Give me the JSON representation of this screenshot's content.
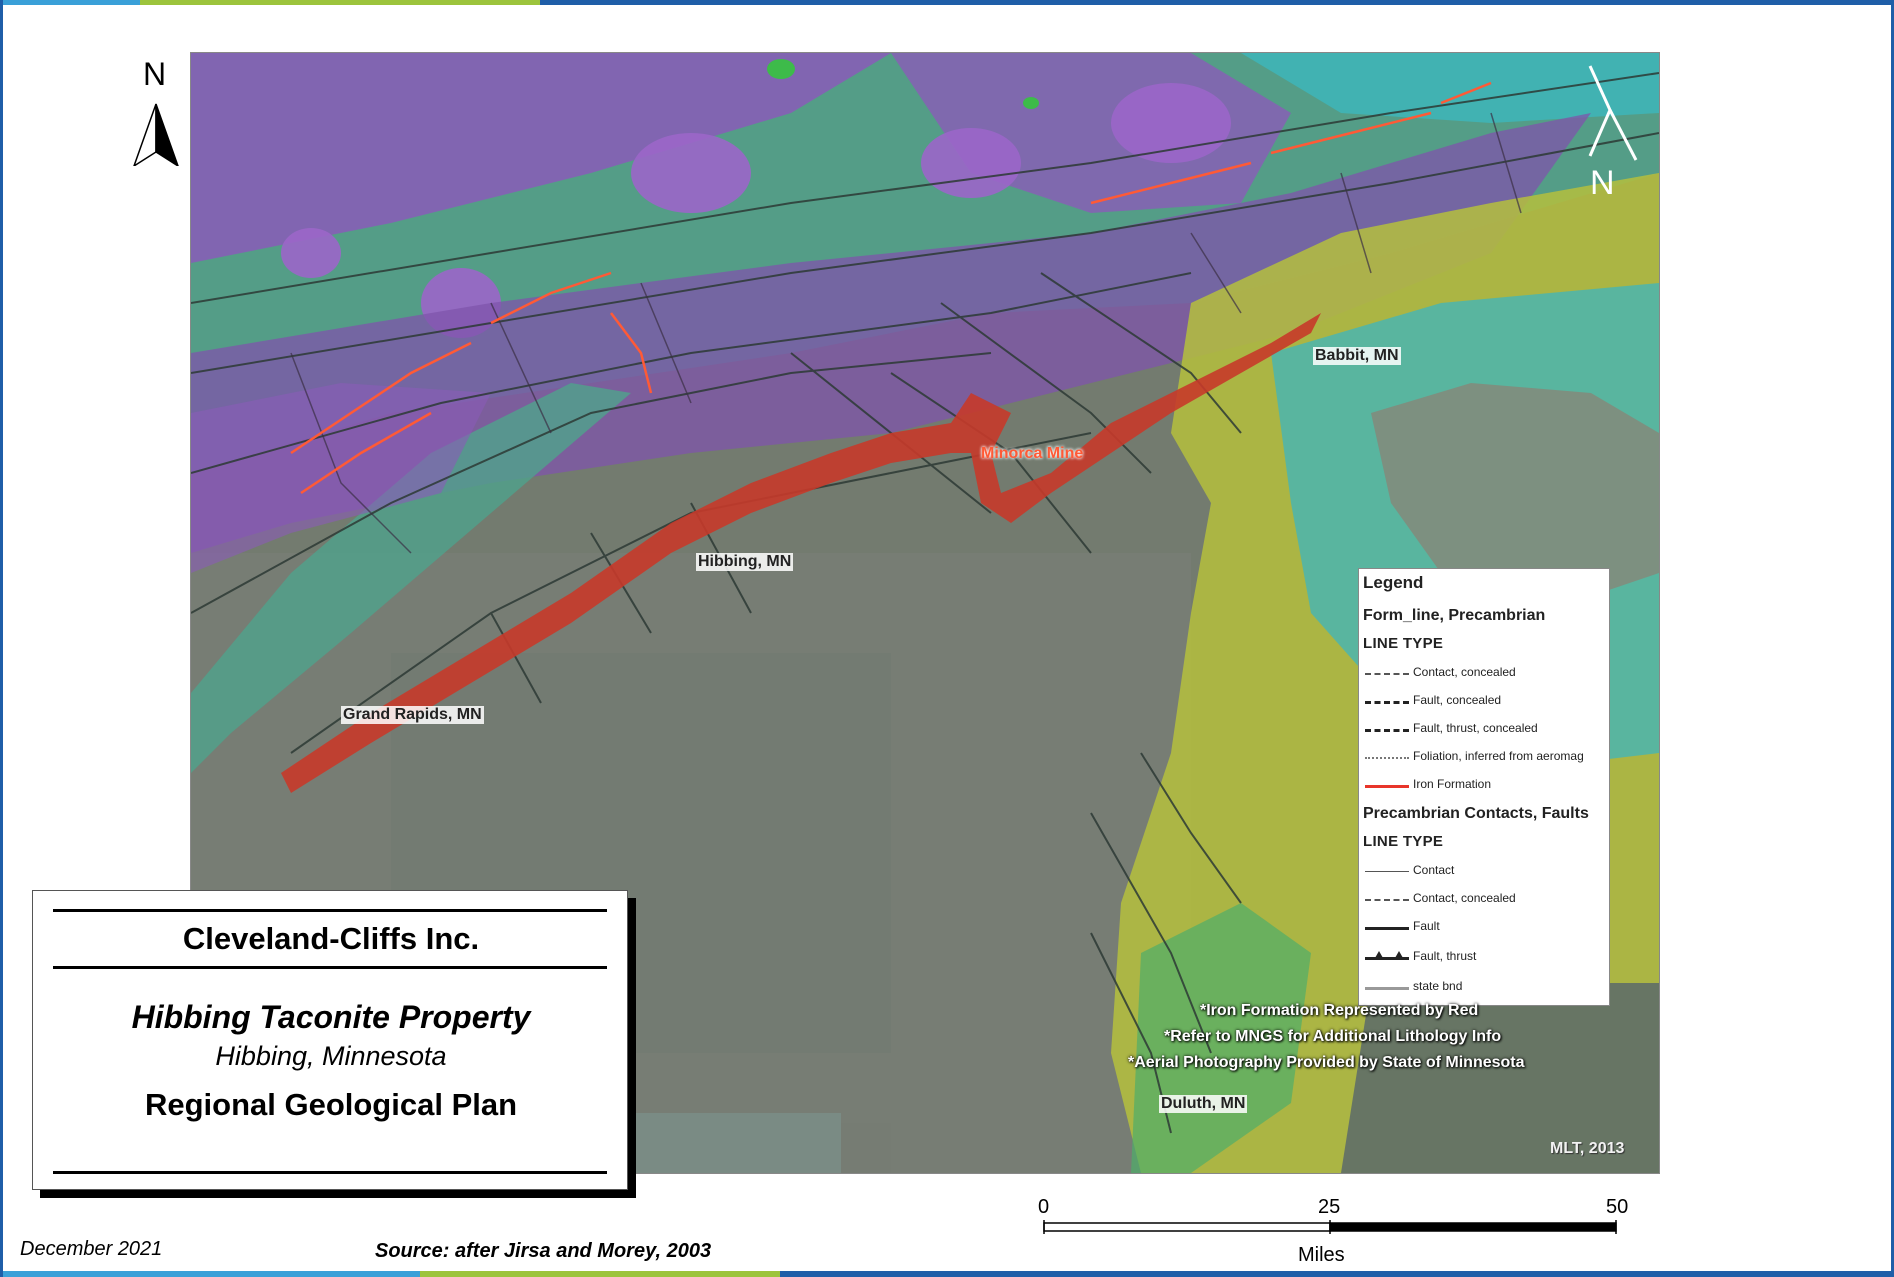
{
  "map": {
    "cities": [
      {
        "id": "babbit",
        "label": "Babbit, MN"
      },
      {
        "id": "minorca",
        "label": "Minorca Mine"
      },
      {
        "id": "hibbing",
        "label": "Hibbing, MN"
      },
      {
        "id": "grand-rapids",
        "label": "Grand Rapids, MN"
      },
      {
        "id": "duluth",
        "label": "Duluth, MN"
      }
    ],
    "north_label": "N",
    "notes": [
      "*Iron Formation Represented by Red",
      "*Refer to MNGS for Additional Lithology Info",
      "*Aerial Photography Provided by State of Minnesota"
    ],
    "credit": "MLT, 2013"
  },
  "legend": {
    "title": "Legend",
    "group1": {
      "header": "Form_line, Precambrian",
      "subheader": "LINE TYPE",
      "items": [
        {
          "label": "Contact, concealed",
          "style": "dash-thin",
          "color": "#555555"
        },
        {
          "label": "Fault, concealed",
          "style": "dash-thick",
          "color": "#222222"
        },
        {
          "label": "Fault, thrust, concealed",
          "style": "dash-thick",
          "color": "#222222"
        },
        {
          "label": "Foliation, inferred from aeromag",
          "style": "dotted",
          "color": "#777777"
        },
        {
          "label": "Iron Formation",
          "style": "solid-thick",
          "color": "#e8352a"
        }
      ]
    },
    "group2": {
      "header": "Precambrian Contacts, Faults",
      "subheader": "LINE TYPE",
      "items": [
        {
          "label": "Contact",
          "style": "solid-thin",
          "color": "#555555"
        },
        {
          "label": "Contact, concealed",
          "style": "dash-thin",
          "color": "#555555"
        },
        {
          "label": "Fault",
          "style": "solid-thick",
          "color": "#222222"
        },
        {
          "label": "Fault, thrust",
          "style": "thrust",
          "color": "#222222"
        },
        {
          "label": "state bnd",
          "style": "solid-gray",
          "color": "#999999"
        }
      ]
    }
  },
  "titlebox": {
    "company": "Cleveland-Cliffs Inc.",
    "property": "Hibbing Taconite Property",
    "location": "Hibbing, Minnesota",
    "plan": "Regional Geological Plan"
  },
  "footer": {
    "date": "December 2021",
    "source": "Source: after Jirsa and Morey, 2003"
  },
  "scale_bar": {
    "ticks": [
      "0",
      "25",
      "50"
    ],
    "unit": "Miles"
  },
  "colors": {
    "iron_formation": "#e8352a",
    "purple_unit": "#8a5cb8",
    "green_unit": "#4fa88a",
    "yellow_unit": "#b9c23c",
    "cyan_unit": "#45b8c0",
    "base_photo": "#707a6e"
  }
}
